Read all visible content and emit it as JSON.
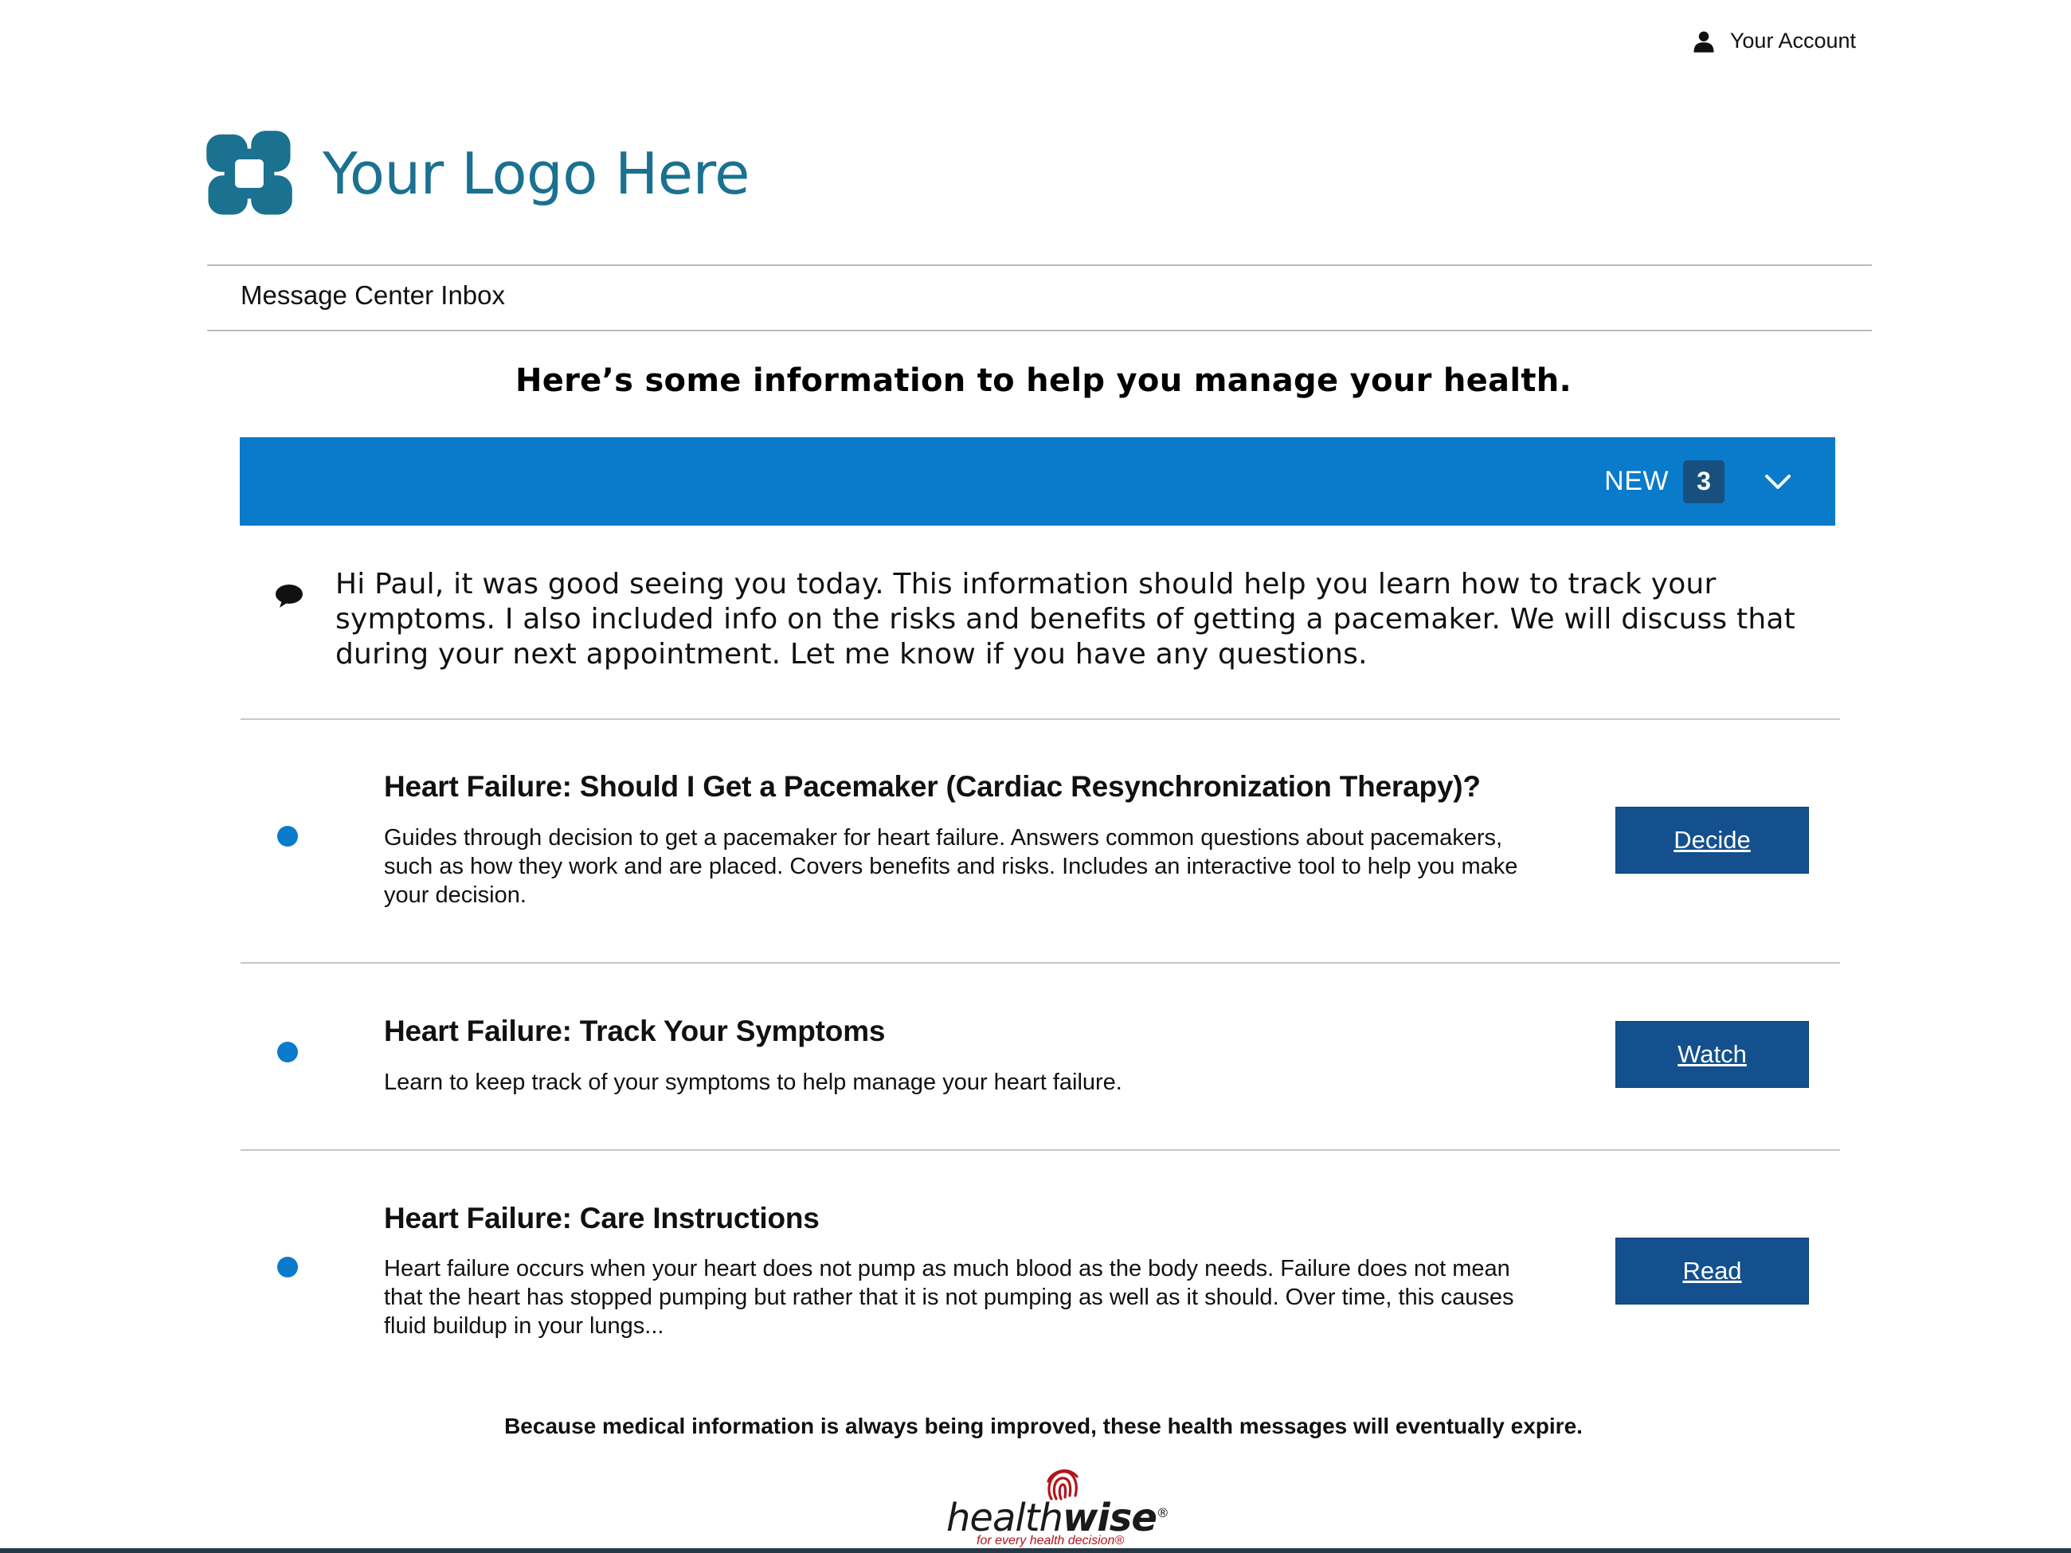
{
  "header": {
    "account_label": "Your Account",
    "account_icon": "user-icon",
    "logo_text": "Your Logo Here",
    "logo_icon": "logo-mark-icon"
  },
  "inbox": {
    "title": "Message Center Inbox",
    "headline": "Here’s some information to help you manage your health."
  },
  "new_bar": {
    "label": "NEW",
    "count": "3",
    "color": "#0a7acb",
    "icon": "chevron-down-icon"
  },
  "message": {
    "icon": "speech-bubble-icon",
    "text": "Hi Paul, it was good seeing you today. This information should help you learn how to track your symptoms. I also included info on the risks and benefits of getting a pacemaker. We will discuss that during your next appointment. Let me know if you have any questions."
  },
  "items": [
    {
      "title": "Heart Failure: Should I Get a Pacemaker (Cardiac Resynchronization Therapy)?",
      "description": "Guides through decision to get a pacemaker for heart failure. Answers common questions about pacemakers, such as how they work and are placed. Covers benefits and risks. Includes an interactive tool to help you make your decision.",
      "button": "Decide"
    },
    {
      "title": "Heart Failure: Track Your Symptoms",
      "description": "Learn to keep track of your symptoms to help manage your heart failure.",
      "button": "Watch"
    },
    {
      "title": "Heart Failure: Care Instructions",
      "description": "Heart failure occurs when your heart does not pump as much blood as the body needs. Failure does not mean that the heart has stopped pumping but rather that it is not pumping as well as it should. Over time, this causes fluid buildup in your lungs...",
      "button": "Read"
    }
  ],
  "footer": {
    "note": "Because medical information is always being improved, these health messages will eventually expire.",
    "brand_light": "health",
    "brand_bold": "wise",
    "brand_reg": "®",
    "tagline": "for every health decision®"
  },
  "colors": {
    "accent_blue": "#0a7acb",
    "button_blue": "#13508d",
    "logo_teal": "#1a7190"
  }
}
